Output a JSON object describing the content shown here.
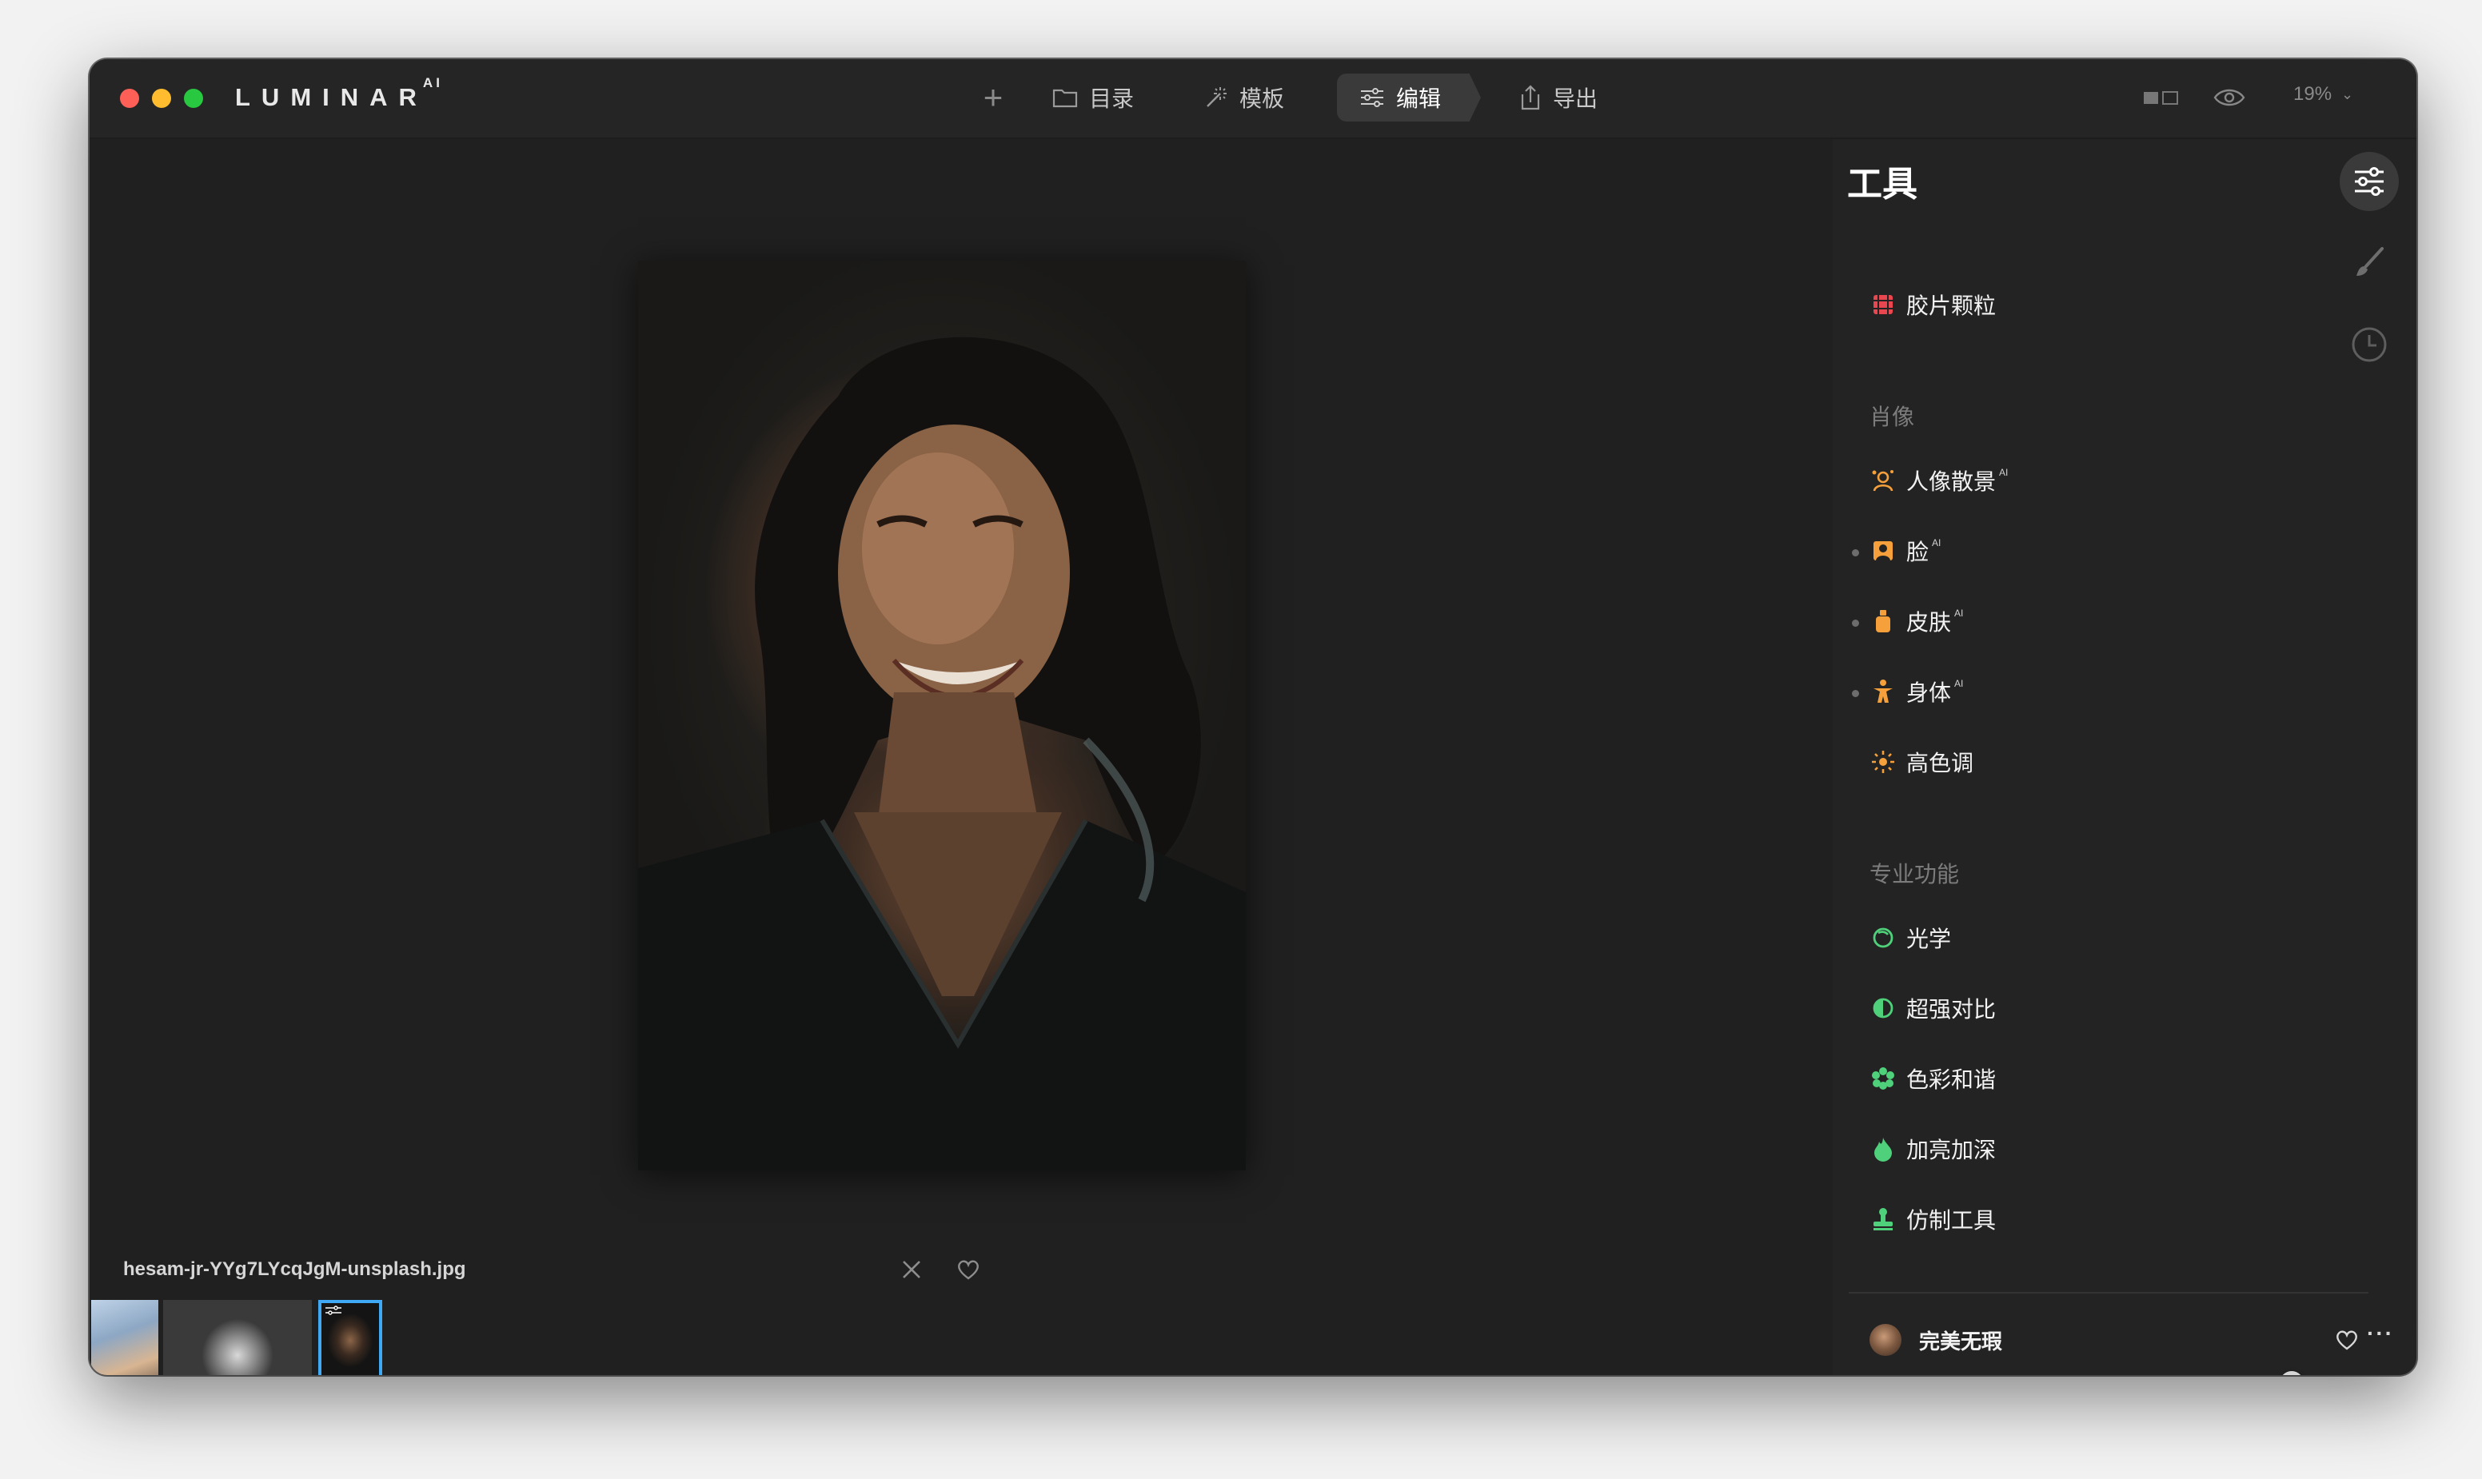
{
  "app": {
    "logo": "LUMINAR",
    "logo_suffix": "AI"
  },
  "toolbar": {
    "add_label": "+",
    "catalog_label": "目录",
    "templates_label": "模板",
    "edit_label": "编辑",
    "export_label": "导出",
    "zoom_value": "19%"
  },
  "canvas": {
    "filename": "hesam-jr-YYg7LYcqJgM-unsplash.jpg"
  },
  "filmstrip": {
    "selected_index": 2
  },
  "tools_panel": {
    "title": "工具",
    "top_tools": [
      {
        "label": "胶片颗粒",
        "icon": "film-grain-icon",
        "color": "#e8474f"
      }
    ],
    "portrait_section": "肖像",
    "portrait_tools": [
      {
        "label": "人像散景",
        "ai": "AI",
        "icon": "portrait-bokeh-icon",
        "color": "#f5a03a"
      },
      {
        "label": "脸",
        "ai": "AI",
        "icon": "face-icon",
        "color": "#f5a03a"
      },
      {
        "label": "皮肤",
        "ai": "AI",
        "icon": "skin-icon",
        "color": "#f5a03a"
      },
      {
        "label": "身体",
        "ai": "AI",
        "icon": "body-icon",
        "color": "#f5a03a"
      },
      {
        "label": "高色调",
        "ai": "",
        "icon": "high-key-icon",
        "color": "#f5a03a"
      }
    ],
    "pro_section": "专业功能",
    "pro_tools": [
      {
        "label": "光学",
        "icon": "optics-icon",
        "color": "#4fd07a"
      },
      {
        "label": "超强对比",
        "icon": "supercontrast-icon",
        "color": "#4fd07a"
      },
      {
        "label": "色彩和谐",
        "icon": "color-harmony-icon",
        "color": "#4fd07a"
      },
      {
        "label": "加亮加深",
        "icon": "dodge-burn-icon",
        "color": "#4fd07a"
      },
      {
        "label": "仿制工具",
        "icon": "clone-stamp-icon",
        "color": "#4fd07a"
      }
    ]
  },
  "preset": {
    "name": "完美无瑕",
    "more_label": "···",
    "amount": 0.96,
    "slider_color": "#2e7fe6"
  }
}
